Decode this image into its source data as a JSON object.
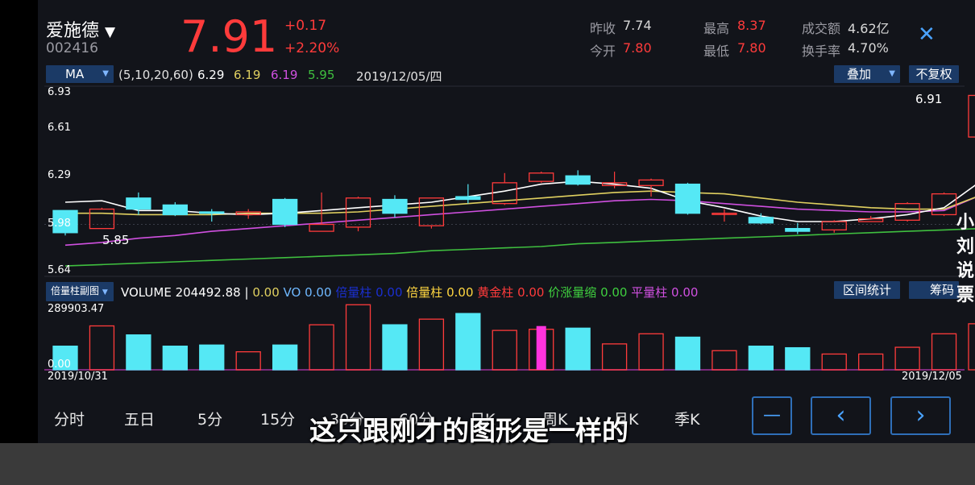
{
  "stock": {
    "name": "爱施德",
    "dropdown_glyph": "▼",
    "code": "002416",
    "price": "7.91",
    "change": "+0.17",
    "change_pct": "+2.20%"
  },
  "quotes": {
    "prev_close_label": "昨收",
    "prev_close": "7.74",
    "open_label": "今开",
    "open": "7.80",
    "high_label": "最高",
    "high": "8.37",
    "low_label": "最低",
    "low": "7.80",
    "amount_label": "成交额",
    "amount": "4.62亿",
    "turnover_label": "换手率",
    "turnover": "4.70%"
  },
  "close_glyph": "✕",
  "ma_bar": {
    "select": "MA",
    "caret": "▼",
    "params": "(5,10,20,60)",
    "ma5": "6.29",
    "ma10": "6.19",
    "ma20": "6.19",
    "ma60": "5.95",
    "date": "2019/12/05/四",
    "overlay_btn": "叠加",
    "overlay_caret": "▼",
    "adjust_btn": "不复权"
  },
  "price_axis": {
    "labels": [
      "6.93",
      "6.61",
      "6.29",
      "5.98",
      "5.64"
    ],
    "last_price_tag": "6.91",
    "low_marker": "5.85"
  },
  "vol_bar": {
    "indicator_btn": "倍量柱副图",
    "indicator_caret": "▼",
    "volume_label": "VOLUME",
    "volume_value": "204492.88",
    "sep": "|",
    "v1": "0.00",
    "vo_label": "VO",
    "vo": "0.00",
    "hidden_label": "倍量柱",
    "hidden_value": "0.00",
    "beiliang_label": "倍量柱",
    "beiliang": "0.00",
    "huangjin_label": "黄金柱",
    "huangjin": "0.00",
    "jiazhang_label": "价涨量缩",
    "jiazhang": "0.00",
    "pingliang_label": "平量柱",
    "pingliang": "0.00",
    "range_btn": "区间统计",
    "chip_btn": "筹码"
  },
  "vol_axis": {
    "max": "289903.47",
    "zero": "0.00"
  },
  "dates": {
    "start": "2019/10/31",
    "end": "2019/12/05"
  },
  "timeframes": [
    "分时",
    "五日",
    "5分",
    "15分",
    "30分",
    "60分",
    "日K",
    "周K",
    "月K",
    "季K"
  ],
  "nav": {
    "minus": "—",
    "prev": "‹",
    "next": "›"
  },
  "watermark": [
    "小",
    "刘",
    "说",
    "票"
  ],
  "subtitle": "这只跟刚才的图形是一样的",
  "colors": {
    "up": "#ff3b3b",
    "down": "#55e8f5",
    "ma5": "#ffffff",
    "ma10": "#e0d060",
    "ma20": "#d050e0",
    "ma60": "#3fbf3f",
    "accent": "#2f6fb8"
  },
  "chart_data": {
    "type": "candlestick",
    "x_start": "2019/10/31",
    "x_end": "2019/12/05",
    "ylim": [
      5.64,
      6.93
    ],
    "volume_ylim": [
      0,
      289903.47
    ],
    "candles": [
      {
        "o": 6.08,
        "c": 5.92,
        "h": 6.08,
        "l": 5.9,
        "v": 105000
      },
      {
        "o": 5.95,
        "c": 6.09,
        "h": 6.1,
        "l": 5.95,
        "v": 195000
      },
      {
        "o": 6.17,
        "c": 6.09,
        "h": 6.21,
        "l": 6.05,
        "v": 155000
      },
      {
        "o": 6.12,
        "c": 6.05,
        "h": 6.14,
        "l": 6.04,
        "v": 105000
      },
      {
        "o": 6.07,
        "c": 6.06,
        "h": 6.09,
        "l": 6.0,
        "v": 110000
      },
      {
        "o": 6.05,
        "c": 6.07,
        "h": 6.09,
        "l": 6.02,
        "v": 80000
      },
      {
        "o": 6.16,
        "c": 5.98,
        "h": 6.17,
        "l": 5.96,
        "v": 110000
      },
      {
        "o": 5.93,
        "c": 5.98,
        "h": 6.21,
        "l": 5.93,
        "v": 200000
      },
      {
        "o": 5.96,
        "c": 6.17,
        "h": 6.18,
        "l": 5.93,
        "v": 289000
      },
      {
        "o": 6.16,
        "c": 6.06,
        "h": 6.19,
        "l": 6.03,
        "v": 200000
      },
      {
        "o": 5.97,
        "c": 6.17,
        "h": 6.17,
        "l": 5.95,
        "v": 225000
      },
      {
        "o": 6.18,
        "c": 6.16,
        "h": 6.27,
        "l": 6.13,
        "v": 250000
      },
      {
        "o": 6.13,
        "c": 6.28,
        "h": 6.35,
        "l": 6.12,
        "v": 175000
      },
      {
        "o": 6.29,
        "c": 6.35,
        "h": 6.36,
        "l": 6.28,
        "v": 180000
      },
      {
        "o": 6.33,
        "c": 6.27,
        "h": 6.37,
        "l": 6.26,
        "v": 185000
      },
      {
        "o": 6.26,
        "c": 6.28,
        "h": 6.36,
        "l": 6.24,
        "v": 115000
      },
      {
        "o": 6.26,
        "c": 6.3,
        "h": 6.31,
        "l": 6.18,
        "v": 160000
      },
      {
        "o": 6.27,
        "c": 6.06,
        "h": 6.28,
        "l": 6.05,
        "v": 145000
      },
      {
        "o": 6.06,
        "c": 6.06,
        "h": 6.09,
        "l": 6.0,
        "v": 85000
      },
      {
        "o": 6.03,
        "c": 5.99,
        "h": 6.06,
        "l": 5.98,
        "v": 105000
      },
      {
        "o": 5.95,
        "c": 5.93,
        "h": 5.99,
        "l": 5.91,
        "v": 98000
      },
      {
        "o": 5.94,
        "c": 6.0,
        "h": 6.01,
        "l": 5.92,
        "v": 70000
      },
      {
        "o": 6.0,
        "c": 6.02,
        "h": 6.04,
        "l": 6.0,
        "v": 70000
      },
      {
        "o": 6.01,
        "c": 6.13,
        "h": 6.14,
        "l": 6.0,
        "v": 100000
      },
      {
        "o": 6.05,
        "c": 6.2,
        "h": 6.21,
        "l": 6.04,
        "v": 160000
      },
      {
        "o": 6.61,
        "c": 6.91,
        "h": 6.93,
        "l": 6.61,
        "v": 204492.88
      }
    ],
    "special_volume_index": 13,
    "ma5": [
      6.14,
      6.15,
      6.08,
      6.08,
      6.06,
      6.05,
      6.06,
      6.08,
      6.1,
      6.12,
      6.14,
      6.18,
      6.22,
      6.27,
      6.29,
      6.27,
      6.24,
      6.15,
      6.1,
      6.04,
      6.0,
      6.0,
      6.02,
      6.05,
      6.1,
      6.29
    ],
    "ma10": [
      6.06,
      6.06,
      6.05,
      6.05,
      6.05,
      6.06,
      6.06,
      6.06,
      6.07,
      6.09,
      6.11,
      6.13,
      6.15,
      6.17,
      6.19,
      6.21,
      6.22,
      6.21,
      6.2,
      6.17,
      6.14,
      6.12,
      6.1,
      6.09,
      6.09,
      6.19
    ],
    "ma20": [
      5.83,
      5.85,
      5.88,
      5.9,
      5.93,
      5.95,
      5.97,
      5.99,
      6.01,
      6.03,
      6.05,
      6.07,
      6.09,
      6.11,
      6.13,
      6.15,
      6.16,
      6.15,
      6.13,
      6.11,
      6.09,
      6.08,
      6.07,
      6.07,
      6.08,
      6.19
    ],
    "ma60": [
      5.68,
      5.69,
      5.7,
      5.71,
      5.72,
      5.73,
      5.74,
      5.75,
      5.76,
      5.77,
      5.79,
      5.8,
      5.81,
      5.82,
      5.84,
      5.85,
      5.86,
      5.87,
      5.88,
      5.89,
      5.9,
      5.91,
      5.92,
      5.93,
      5.94,
      5.95
    ]
  }
}
